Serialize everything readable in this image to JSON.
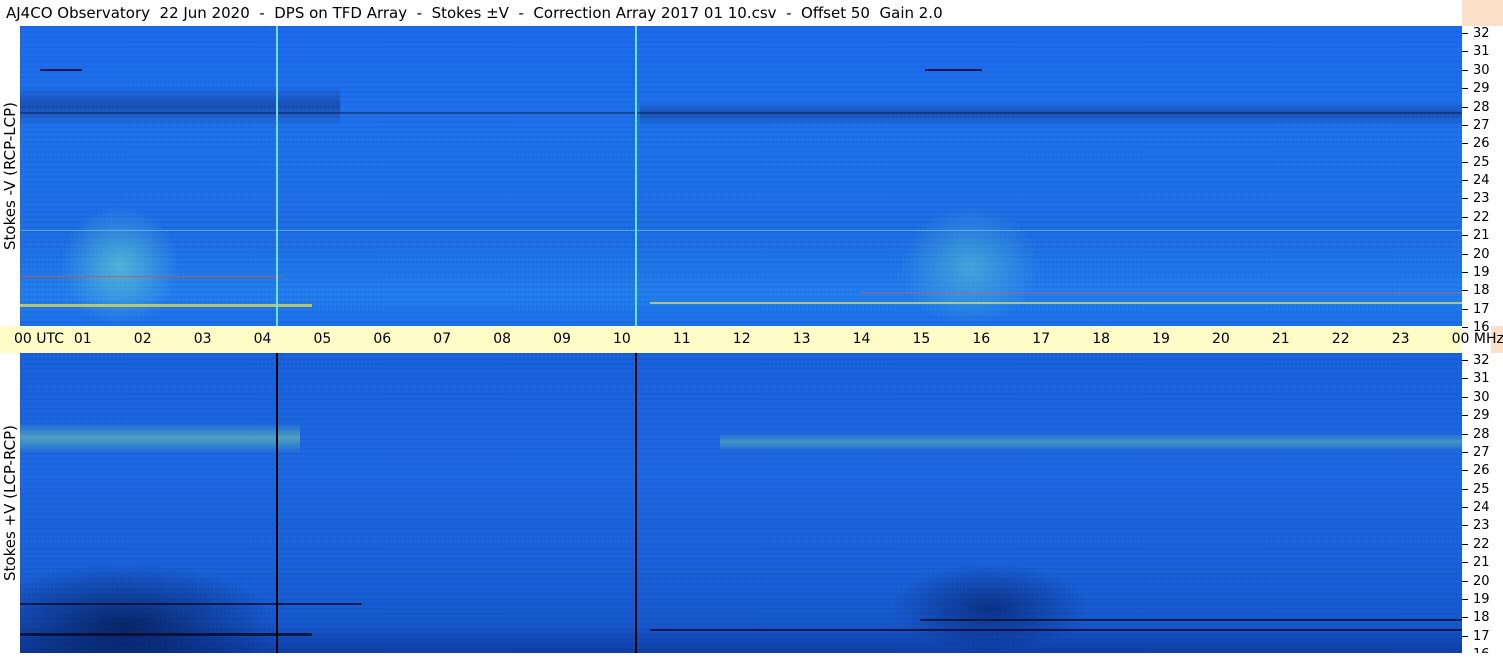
{
  "title": "AJ4CO Observatory  22 Jun 2020  -  DPS on TFD Array  -  Stokes ±V  -  Correction Array 2017 01 10.csv  -  Offset 50  Gain 2.0",
  "top_panel": {
    "label": "Stokes -V (RCP-LCP)"
  },
  "bottom_panel": {
    "label": "Stokes +V (LCP-RCP)"
  },
  "time_axis": {
    "labels": [
      "00 UTC",
      "01",
      "02",
      "03",
      "04",
      "05",
      "06",
      "07",
      "08",
      "09",
      "10",
      "11",
      "12",
      "13",
      "14",
      "15",
      "16",
      "17",
      "18",
      "19",
      "20",
      "21",
      "22",
      "23",
      "00 MHz"
    ]
  },
  "freq_axis": {
    "labels": [
      "32",
      "31",
      "30",
      "29",
      "28",
      "27",
      "26",
      "25",
      "24",
      "23",
      "22",
      "21",
      "20",
      "19",
      "18",
      "17",
      "16"
    ]
  },
  "colors": {
    "background_blue": "#1e6fe6",
    "time_bar": "#fffcc8",
    "frame_strip": "#fde0c8"
  }
}
